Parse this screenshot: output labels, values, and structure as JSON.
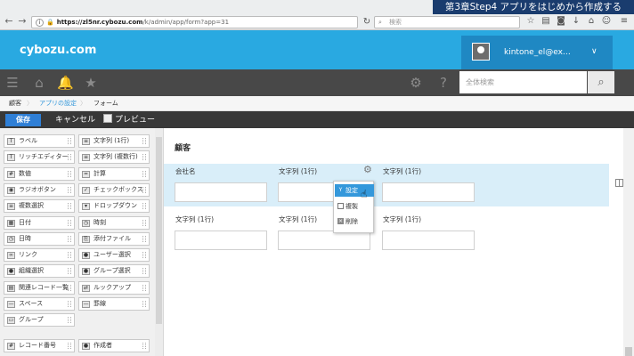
{
  "banner": "第3章Step4 アプリをはじめから作成する",
  "browser": {
    "url_host": "https://zl5nr.cybozu.com",
    "url_path": "/k/admin/app/form?app=31",
    "search_placeholder": "検索"
  },
  "header": {
    "logo": "cybozu.com",
    "user": "kintone_el@ex…"
  },
  "globalbar": {
    "search_placeholder": "全体検索"
  },
  "breadcrumb": [
    "顧客",
    "アプリの設定",
    "フォーム"
  ],
  "toolbar": {
    "save": "保存",
    "cancel": "キャンセル",
    "preview": "プレビュー"
  },
  "palette": [
    {
      "label": "ラベル",
      "icon": "T"
    },
    {
      "label": "文字列 (1行)",
      "icon": "≡"
    },
    {
      "label": "リッチエディター",
      "icon": "T"
    },
    {
      "label": "文字列 (複数行)",
      "icon": "≡"
    },
    {
      "label": "数値",
      "icon": "#"
    },
    {
      "label": "計算",
      "icon": "="
    },
    {
      "label": "ラジオボタン",
      "icon": "◉"
    },
    {
      "label": "チェックボックス",
      "icon": "✓"
    },
    {
      "label": "複数選択",
      "icon": "≡"
    },
    {
      "label": "ドロップダウン",
      "icon": "▾"
    },
    {
      "label": "日付",
      "icon": "▦"
    },
    {
      "label": "時刻",
      "icon": "◷"
    },
    {
      "label": "日時",
      "icon": "◷"
    },
    {
      "label": "添付ファイル",
      "icon": "⎘"
    },
    {
      "label": "リンク",
      "icon": "∞"
    },
    {
      "label": "ユーザー選択",
      "icon": "●"
    },
    {
      "label": "組織選択",
      "icon": "●"
    },
    {
      "label": "グループ選択",
      "icon": "●"
    },
    {
      "label": "関連レコード一覧",
      "icon": "▤"
    },
    {
      "label": "ルックアップ",
      "icon": "⇄"
    },
    {
      "label": "スペース",
      "icon": "—"
    },
    {
      "label": "罫線",
      "icon": "—"
    },
    {
      "label": "グループ",
      "icon": "▭"
    },
    {
      "label": "",
      "icon": ""
    },
    {
      "label": "レコード番号",
      "icon": "#"
    },
    {
      "label": "作成者",
      "icon": "●"
    }
  ],
  "form": {
    "title": "顧客",
    "fields": [
      {
        "label": "会社名"
      },
      {
        "label": "文字列 (1行)"
      },
      {
        "label": "文字列 (1行)"
      },
      {
        "label": "文字列 (1行)"
      },
      {
        "label": "文字列 (1行)"
      },
      {
        "label": "文字列 (1行)"
      }
    ]
  },
  "context_menu": [
    "設定",
    "複製",
    "削除"
  ]
}
